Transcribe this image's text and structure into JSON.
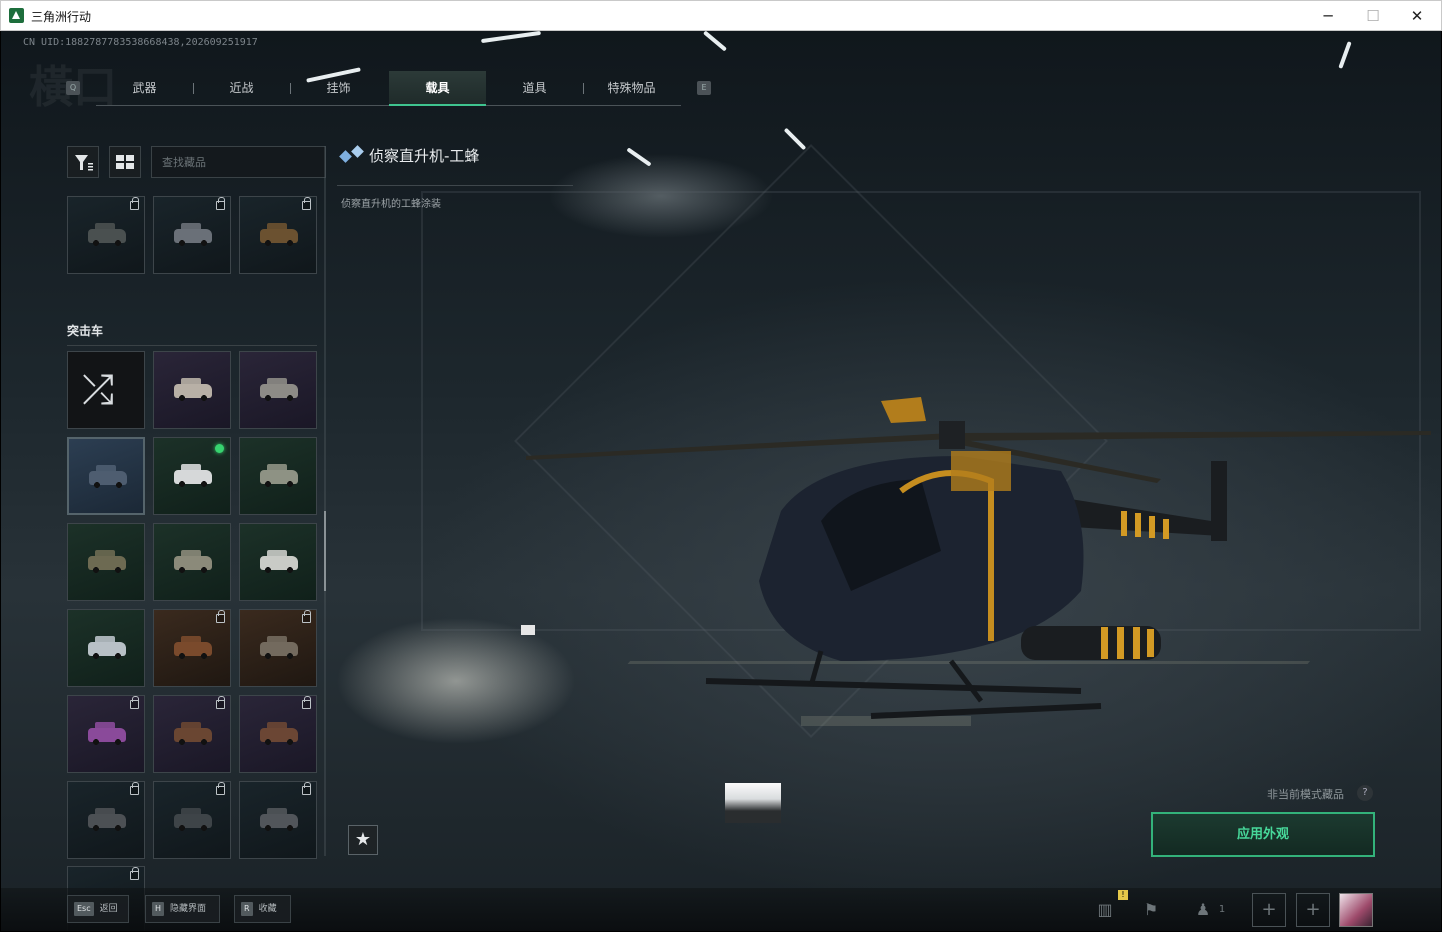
{
  "window": {
    "title": "三角洲行动",
    "min": "─",
    "max": "☐",
    "close": "✕"
  },
  "uid": "CN UID:1882787783538668438,202609251917",
  "watermark": "橫口",
  "tabs": {
    "prev_key": "Q",
    "next_key": "E",
    "items": [
      {
        "label": "武器",
        "active": false
      },
      {
        "label": "近战",
        "active": false
      },
      {
        "label": "挂饰",
        "active": false
      },
      {
        "label": "载具",
        "active": true
      },
      {
        "label": "道具",
        "active": false
      },
      {
        "label": "特殊物品",
        "active": false
      }
    ]
  },
  "search": {
    "placeholder": "查找藏品",
    "value": ""
  },
  "section_label": "突击车",
  "item": {
    "title": "侦察直升机-工蜂",
    "description": "侦察直升机的工蜂涂装",
    "favorite_icon": "★"
  },
  "non_current_mode": "非当前模式藏品",
  "help_icon": "?",
  "apply_button": "应用外观",
  "hints": [
    {
      "key": "Esc",
      "label": "返回"
    },
    {
      "key": "H",
      "label": "隐藏界面"
    },
    {
      "key": "R",
      "label": "收藏"
    }
  ],
  "squad_count": "1",
  "alert_badge": "!",
  "colors": {
    "accent": "#3fc38f",
    "apply_border": "#33b27a",
    "equipped_dot": "#37d36f"
  }
}
